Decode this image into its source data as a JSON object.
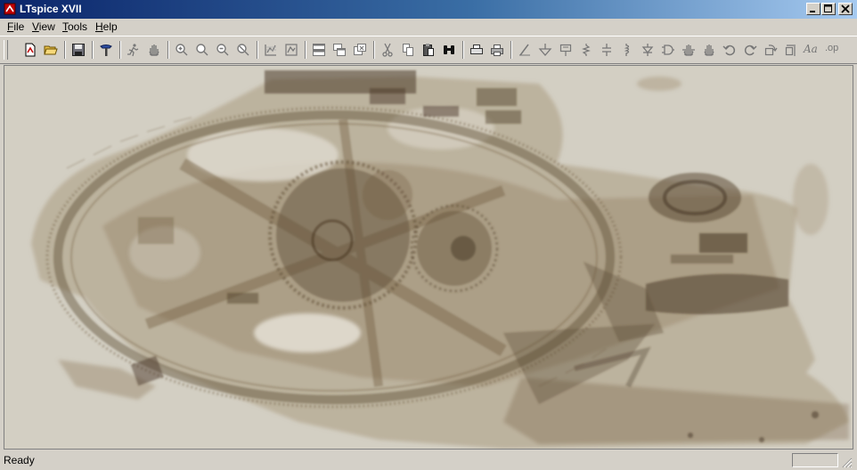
{
  "window": {
    "title": "LTspice XVII"
  },
  "menubar": {
    "items": [
      {
        "label": "File",
        "mnemonic": "F",
        "rest": "ile"
      },
      {
        "label": "View",
        "mnemonic": "V",
        "rest": "iew"
      },
      {
        "label": "Tools",
        "mnemonic": "T",
        "rest": "ools"
      },
      {
        "label": "Help",
        "mnemonic": "H",
        "rest": "elp"
      }
    ]
  },
  "toolbar": {
    "text_tool_label": "Aa",
    "spice_directive_label": ".op"
  },
  "statusbar": {
    "status_text": "Ready",
    "pane_text": ""
  },
  "colors": {
    "title_gradient_start": "#0a246a",
    "title_gradient_end": "#a6caf0",
    "chrome": "#d4d0c8",
    "workspace_background": "#d3cfc3",
    "watermark_tint": "#6f5a3e"
  },
  "workspace": {
    "background_image": "sepia x-ray watermark of a gear mechanism"
  }
}
